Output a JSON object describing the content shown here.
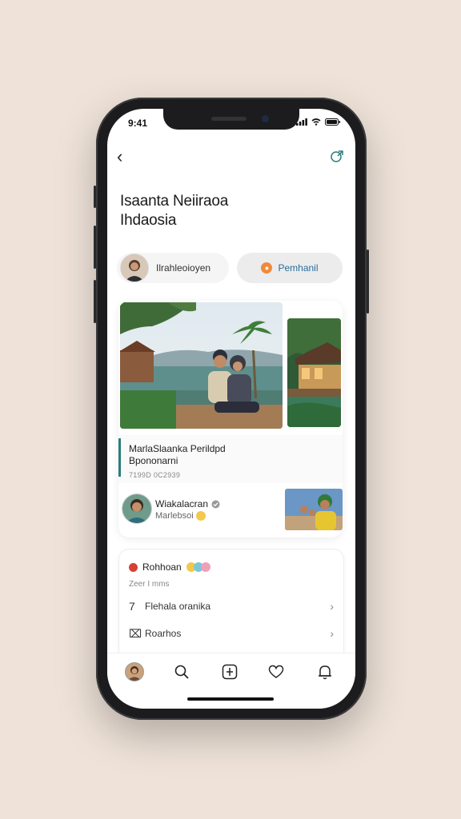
{
  "status": {
    "time": "9:41"
  },
  "header": {
    "title_line1": "Isaanta Neiiraoa",
    "title_line2": "Ihdaosia"
  },
  "chips": {
    "user_label": "Ilrahleoioyen",
    "tag_label": "Pemhanil"
  },
  "post": {
    "caption_line1": "MarlaSlaanka Perildpd",
    "caption_line2": "Bpononarni",
    "caption_meta": "7199D 0C2939",
    "author_name": "Wiakalacran",
    "author_sub": "Marlebsoi"
  },
  "section": {
    "header": "Rohhoan",
    "count": "Zeer I mms",
    "rows": [
      {
        "icon": "7",
        "label": "Flehala oranika"
      },
      {
        "icon": "⌧",
        "label": "Roarhos"
      }
    ]
  },
  "colors": {
    "accent_teal": "#2b7d7e",
    "tag_text": "#2a6d9a",
    "tag_dot": "#f08a3a",
    "record_dot": "#d64035"
  }
}
